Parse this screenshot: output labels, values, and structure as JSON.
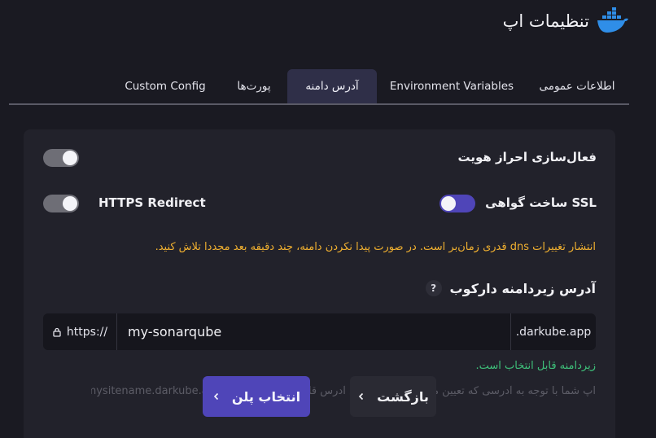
{
  "header": {
    "title": "تنظیمات اپ",
    "brand_color": "#2f8ee8"
  },
  "tabs": [
    {
      "id": "general",
      "label": "اطلاعات عمومی"
    },
    {
      "id": "env",
      "label": "Environment Variables"
    },
    {
      "id": "domain",
      "label": "آدرس دامنه",
      "active": true
    },
    {
      "id": "ports",
      "label": "پورت‌ها"
    },
    {
      "id": "custom",
      "label": "Custom Config"
    }
  ],
  "settings": {
    "auth_label": "فعال‌سازی احراز هویت",
    "auth_enabled": false,
    "ssl_label": "ساخت گواهی SSL",
    "ssl_enabled": true,
    "https_label": "HTTPS Redirect",
    "https_enabled": false
  },
  "notice": "انتشار تغییرات dns قدری زمان‌بر است. در صورت پیدا نکردن دامنه، چند دقیقه بعد مجددا تلاش کنید.",
  "subdomain": {
    "label": "آدرس زیردامنه دارکوب",
    "help": "?",
    "prefix": "https://",
    "value": "my-sonarqube",
    "suffix": ".darkube.app",
    "status": "زیردامنه قابل انتخاب است.",
    "hint": "اپ شما با توجه به آدرسی که تعیین می‌کنید از طریق این آدرس قابل دسترسی است .mysitename.darkube.app"
  },
  "actions": {
    "select_plan": "انتخاب پلن",
    "back": "بازگشت"
  },
  "colors": {
    "accent": "#4f45b8",
    "warning": "#f0b030",
    "success": "#3ec07a"
  }
}
